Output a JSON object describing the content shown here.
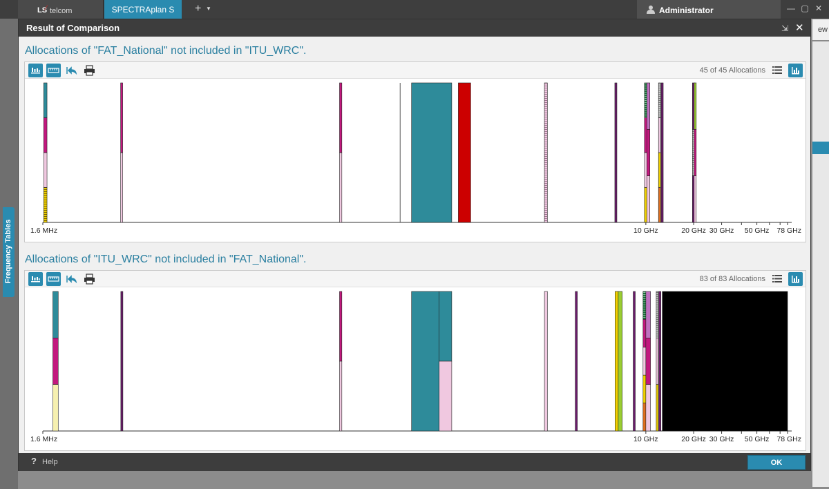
{
  "app": {
    "logo_ls": "LS",
    "logo_telcom": "telcom",
    "active_tab": "SPECTRAplan S",
    "add_tab": "+",
    "user": "Administrator",
    "side_tab": "Frequency Tables",
    "bg_right_text": "ew"
  },
  "dialog": {
    "title": "Result of Comparison",
    "help_label": "Help",
    "help_icon": "?",
    "ok_label": "OK"
  },
  "panels": [
    {
      "title": "Allocations of \"FAT_National\" not included in \"ITU_WRC\".",
      "count_label": "45 of 45 Allocations"
    },
    {
      "title": "Allocations of \"ITU_WRC\" not included in \"FAT_National\".",
      "count_label": "83 of 83 Allocations"
    }
  ],
  "icons": {
    "toolbar": [
      "bar-chart-view-icon",
      "ruler-icon",
      "undo-zoom-icon",
      "print-icon"
    ],
    "list_view": "list-view-icon",
    "chart_view": "chart-view-icon",
    "user": "user-icon",
    "close": "close-icon",
    "collapse": "collapse-icon"
  },
  "colors": {
    "accent": "#2a8bb0",
    "teal": "#2e8b9a",
    "magenta": "#c2187e",
    "pink": "#f0c8e0",
    "yellow": "#f0d000",
    "red": "#cc0000",
    "purple": "#6a1b6a",
    "mauve": "#c070c0",
    "green": "#1b6b3a",
    "orange": "#e07020",
    "lime": "#9acd32",
    "cream": "#f6f0b0",
    "black": "#000000"
  },
  "chart_data": [
    {
      "type": "bar",
      "title": "Allocations of \"FAT_National\" not included in \"ITU_WRC\".",
      "x_scale": "log",
      "x_unit": "Hz",
      "xlim": [
        1600000,
        78000000000
      ],
      "x_ticks": [
        {
          "value": 1600000,
          "label": "1.6 MHz"
        },
        {
          "value": 10000000000,
          "label": "10 GHz"
        },
        {
          "value": 20000000000,
          "label": "20 GHz"
        },
        {
          "value": 30000000000,
          "label": "30 GHz"
        },
        {
          "value": 40000000000,
          "label": ""
        },
        {
          "value": 50000000000,
          "label": "50 GHz"
        },
        {
          "value": 60000000000,
          "label": ""
        },
        {
          "value": 70000000000,
          "label": ""
        },
        {
          "value": 78000000000,
          "label": "78 GHz"
        }
      ],
      "bands": [
        {
          "start": 1620000,
          "end": 1700000,
          "stack": [
            "teal",
            "magenta",
            "pink",
            "yellow-hatch"
          ]
        },
        {
          "start": 4980000,
          "end": 5050000,
          "stack": [
            "magenta",
            "pink"
          ]
        },
        {
          "start": 118000000,
          "end": 122000000,
          "stack": [
            "magenta",
            "pink"
          ]
        },
        {
          "start": 285000000,
          "end": 286000000,
          "stack": [
            "line"
          ]
        },
        {
          "start": 335000000,
          "end": 600000000,
          "stack": [
            "teal"
          ]
        },
        {
          "start": 660000000,
          "end": 790000000,
          "stack": [
            "red"
          ]
        },
        {
          "start": 2300000000,
          "end": 2400000000,
          "stack": [
            "pink-hatch"
          ]
        },
        {
          "start": 6425000000,
          "end": 6525000000,
          "stack": [
            "purple"
          ]
        },
        {
          "start": 9800000000,
          "end": 10150000000,
          "stack": [
            "green-hatch",
            "magenta",
            "pink",
            "yellow"
          ]
        },
        {
          "start": 10150000000,
          "end": 10600000000,
          "stack": [
            "mauve",
            "magenta",
            "pink"
          ]
        },
        {
          "start": 12100000000,
          "end": 12300000000,
          "stack": [
            "gray-hatch",
            "pink",
            "yellow",
            "orange"
          ]
        },
        {
          "start": 12600000000,
          "end": 12750000000,
          "stack": [
            "purple"
          ]
        },
        {
          "start": 19700000000,
          "end": 20200000000,
          "stack": [
            "purple",
            "gray-hatch",
            "purple"
          ]
        },
        {
          "start": 20200000000,
          "end": 20700000000,
          "stack": [
            "lime",
            "magenta",
            "pink"
          ]
        }
      ]
    },
    {
      "type": "bar",
      "title": "Allocations of \"ITU_WRC\" not included in \"FAT_National\".",
      "x_scale": "log",
      "x_unit": "Hz",
      "xlim": [
        1600000,
        78000000000
      ],
      "x_ticks": [
        {
          "value": 1600000,
          "label": "1.6 MHz"
        },
        {
          "value": 10000000000,
          "label": "10 GHz"
        },
        {
          "value": 20000000000,
          "label": "20 GHz"
        },
        {
          "value": 30000000000,
          "label": "30 GHz"
        },
        {
          "value": 40000000000,
          "label": ""
        },
        {
          "value": 50000000000,
          "label": "50 GHz"
        },
        {
          "value": 60000000000,
          "label": ""
        },
        {
          "value": 70000000000,
          "label": ""
        },
        {
          "value": 78000000000,
          "label": "78 GHz"
        }
      ],
      "bands": [
        {
          "start": 1850000,
          "end": 2000000,
          "stack": [
            "teal",
            "magenta",
            "cream"
          ]
        },
        {
          "start": 5000000,
          "end": 5060000,
          "stack": [
            "purple"
          ]
        },
        {
          "start": 118000000,
          "end": 122000000,
          "stack": [
            "magenta",
            "pink"
          ]
        },
        {
          "start": 335000000,
          "end": 500000000,
          "stack": [
            "teal"
          ]
        },
        {
          "start": 500000000,
          "end": 600000000,
          "stack": [
            "teal",
            "pink"
          ]
        },
        {
          "start": 2300000000,
          "end": 2400000000,
          "stack": [
            "pink"
          ]
        },
        {
          "start": 3600000000,
          "end": 3700000000,
          "stack": [
            "purple"
          ]
        },
        {
          "start": 6400000000,
          "end": 6700000000,
          "stack": [
            "yellow"
          ]
        },
        {
          "start": 6700000000,
          "end": 7100000000,
          "stack": [
            "lime"
          ]
        },
        {
          "start": 8400000000,
          "end": 8500000000,
          "stack": [
            "purple"
          ]
        },
        {
          "start": 9600000000,
          "end": 10000000000,
          "stack": [
            "green-hatch",
            "magenta",
            "pink",
            "yellow",
            "orange"
          ]
        },
        {
          "start": 10000000000,
          "end": 10700000000,
          "stack": [
            "mauve",
            "magenta",
            "pink"
          ]
        },
        {
          "start": 11700000000,
          "end": 11900000000,
          "stack": [
            "gray-hatch",
            "pink",
            "yellow"
          ]
        },
        {
          "start": 12200000000,
          "end": 12300000000,
          "stack": [
            "purple"
          ]
        },
        {
          "start": 12700000000,
          "end": 78000000000,
          "stack": [
            "black"
          ]
        }
      ]
    }
  ]
}
